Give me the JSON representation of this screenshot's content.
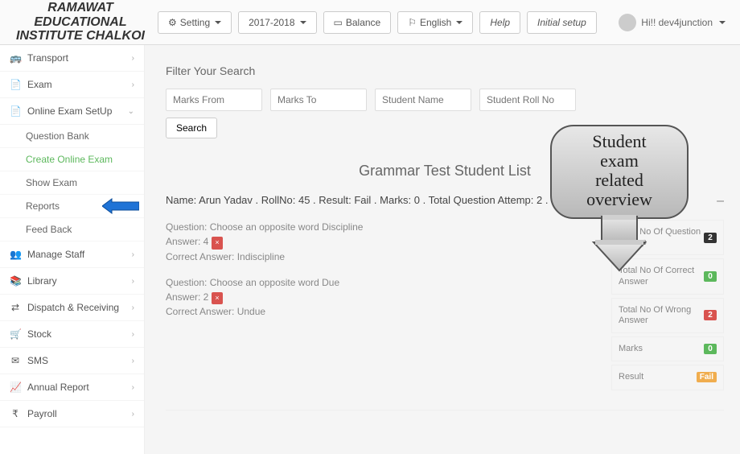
{
  "brand_line1": "RAMAWAT EDUCATIONAL",
  "brand_line2": "INSTITUTE CHALKOI",
  "toolbar": {
    "setting": "Setting",
    "year": "2017-2018",
    "balance": "Balance",
    "english": "English",
    "help": "Help",
    "initial": "Initial setup"
  },
  "user_greeting": "Hi!! dev4junction",
  "sidebar": {
    "transport": "Transport",
    "exam": "Exam",
    "online_exam_setup": "Online Exam SetUp",
    "question_bank": "Question Bank",
    "create_online_exam": "Create Online Exam",
    "show_exam": "Show Exam",
    "reports": "Reports",
    "feedback": "Feed Back",
    "manage_staff": "Manage Staff",
    "library": "Library",
    "dispatch": "Dispatch & Receiving",
    "stock": "Stock",
    "sms": "SMS",
    "annual_report": "Annual Report",
    "payroll": "Payroll"
  },
  "filter": {
    "title": "Filter Your Search",
    "marks_from": "Marks From",
    "marks_to": "Marks To",
    "student_name": "Student Name",
    "student_roll": "Student Roll No",
    "search": "Search"
  },
  "list_title": "Grammar Test Student List",
  "summary": "Name: Arun Yadav . RollNo: 45 . Result: Fail . Marks: 0 . Total Question Attemp: 2 . Total Question: 2.",
  "collapse_sym": "–",
  "q1": {
    "q": "Question: Choose an opposite word Discipline",
    "a": "Answer: 4",
    "c": "Correct Answer: Indiscipline"
  },
  "q2": {
    "q": "Question: Choose an opposite word Due",
    "a": "Answer: 2",
    "c": "Correct Answer: Undue"
  },
  "stats": {
    "attemp_lbl": "Total No Of Question Attemp",
    "attemp_val": "2",
    "correct_lbl": "Total No Of Correct Answer",
    "correct_val": "0",
    "wrong_lbl": "Total No Of Wrong Answer",
    "wrong_val": "2",
    "marks_lbl": "Marks",
    "marks_val": "0",
    "result_lbl": "Result",
    "result_val": "Fail"
  },
  "callout": {
    "l1": "Student",
    "l2": "exam",
    "l3": "related",
    "l4": "overview"
  }
}
